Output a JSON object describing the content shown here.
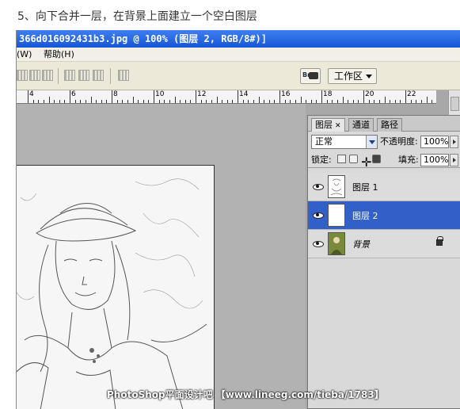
{
  "caption": "5、向下合并一层，在背景上面建立一个空白图层",
  "window": {
    "title": "366d016092431b3.jpg @ 100% (图层 2, RGB/8#)]"
  },
  "menu": {
    "items": [
      "(W)",
      "帮助(H)"
    ]
  },
  "toolbar": {
    "workspace_label": "工作区",
    "bridge_label": "Br"
  },
  "ruler": {
    "labels": [
      "4",
      "6",
      "8",
      "10",
      "12",
      "14",
      "16",
      "18",
      "20",
      "22"
    ]
  },
  "layers_panel": {
    "tabs": [
      "图层",
      "通道",
      "路径"
    ],
    "blend_mode": "正常",
    "opacity_label": "不透明度:",
    "opacity": "100%",
    "lock_label": "锁定:",
    "fill_label": "填充:",
    "fill": "100%",
    "layers": [
      {
        "name": "图层 1",
        "visible": true,
        "selected": false
      },
      {
        "name": "图层 2",
        "visible": true,
        "selected": true
      },
      {
        "name": "背景",
        "visible": true,
        "selected": false,
        "locked": true
      }
    ]
  },
  "watermark": "PhotoShop平面设计吧 【www.lineeg.com/tieba/1783】",
  "colors": {
    "title_bar": "#1656d6",
    "selected_layer": "#3160c9",
    "panel_bg": "#d9d9d9"
  }
}
